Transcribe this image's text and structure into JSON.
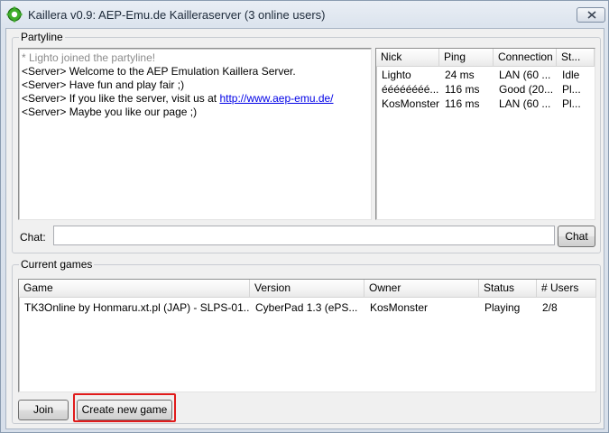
{
  "window": {
    "title": "Kaillera v0.9: AEP-Emu.de Kailleraserver (3 online users)"
  },
  "partyline": {
    "label": "Partyline",
    "messages": {
      "0": {
        "text": "* Lighto joined the partyline!",
        "kind": "system"
      },
      "1": {
        "text": "<Server> Welcome to the AEP Emulation Kaillera Server."
      },
      "2": {
        "text": "<Server> Have fun and play fair ;)"
      },
      "3": {
        "text": "<Server> If you like the server, visit us at ",
        "link": "http://www.aep-emu.de/"
      },
      "4": {
        "text": "<Server> Maybe you like our page ;)"
      }
    },
    "users": {
      "columns": [
        "Nick",
        "Ping",
        "Connection",
        "St..."
      ],
      "rows": [
        [
          "Lighto",
          "24 ms",
          "LAN (60 ...",
          "Idle"
        ],
        [
          "éééééééé...",
          "116 ms",
          "Good (20...",
          "Pl..."
        ],
        [
          "KosMonster",
          "116 ms",
          "LAN (60 ...",
          "Pl..."
        ]
      ]
    },
    "chat_label": "Chat:",
    "chat_value": "",
    "chat_button": "Chat"
  },
  "games": {
    "label": "Current games",
    "columns": [
      "Game",
      "Version",
      "Owner",
      "Status",
      "# Users"
    ],
    "rows": [
      [
        "TK3Online by Honmaru.xt.pl   (JAP) - SLPS-01...",
        "CyberPad 1.3 (ePS...",
        "KosMonster",
        "Playing",
        "2/8"
      ]
    ],
    "join_button": "Join",
    "create_button": "Create new game"
  },
  "colors": {
    "highlight": "#e01b1b",
    "system_message": "#8c8c8c",
    "link": "#0000e6"
  }
}
